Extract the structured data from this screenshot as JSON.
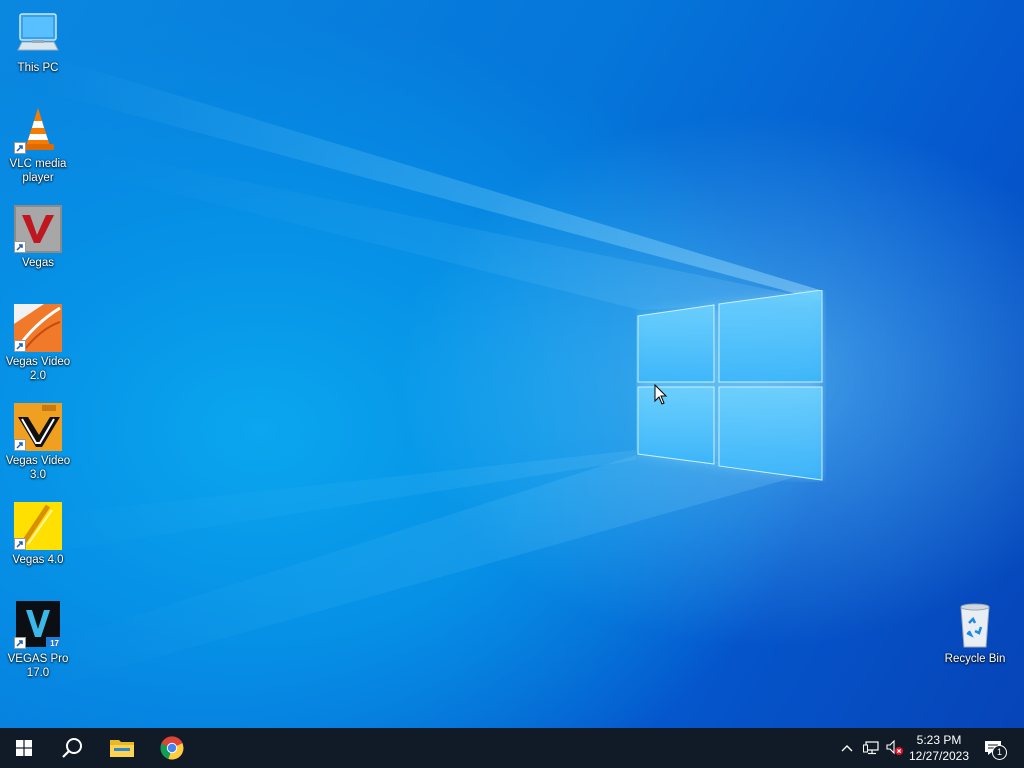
{
  "desktop": {
    "icons": [
      {
        "label": "This PC",
        "icon": "this-pc-icon"
      },
      {
        "label": "VLC media player",
        "icon": "vlc-icon"
      },
      {
        "label": "Vegas",
        "icon": "vegas-icon"
      },
      {
        "label": "Vegas Video 2.0",
        "icon": "vegas-video-2-icon"
      },
      {
        "label": "Vegas Video 3.0",
        "icon": "vegas-video-3-icon"
      },
      {
        "label": "Vegas 4.0",
        "icon": "vegas-4-icon"
      },
      {
        "label": "VEGAS Pro 17.0",
        "icon": "vegas-pro-17-icon",
        "badge": "17"
      },
      {
        "label": "Recycle Bin",
        "icon": "recycle-bin-icon"
      }
    ],
    "wallpaper": "windows-10-default",
    "colors": {
      "wallpaper_blue": "#0a88e0",
      "taskbar": "#111a27"
    }
  },
  "taskbar": {
    "start_icon": "windows-start-icon",
    "search_icon": "search-icon",
    "pinned": [
      {
        "name": "File Explorer",
        "icon": "file-explorer-icon"
      },
      {
        "name": "Google Chrome",
        "icon": "chrome-icon"
      }
    ],
    "tray": {
      "chevron_icon": "chevron-up-icon",
      "network_icon": "network-icon",
      "volume_icon": "volume-muted-icon",
      "time": "5:23 PM",
      "date": "12/27/2023",
      "notifications_icon": "notifications-icon",
      "notification_count": "1"
    }
  }
}
